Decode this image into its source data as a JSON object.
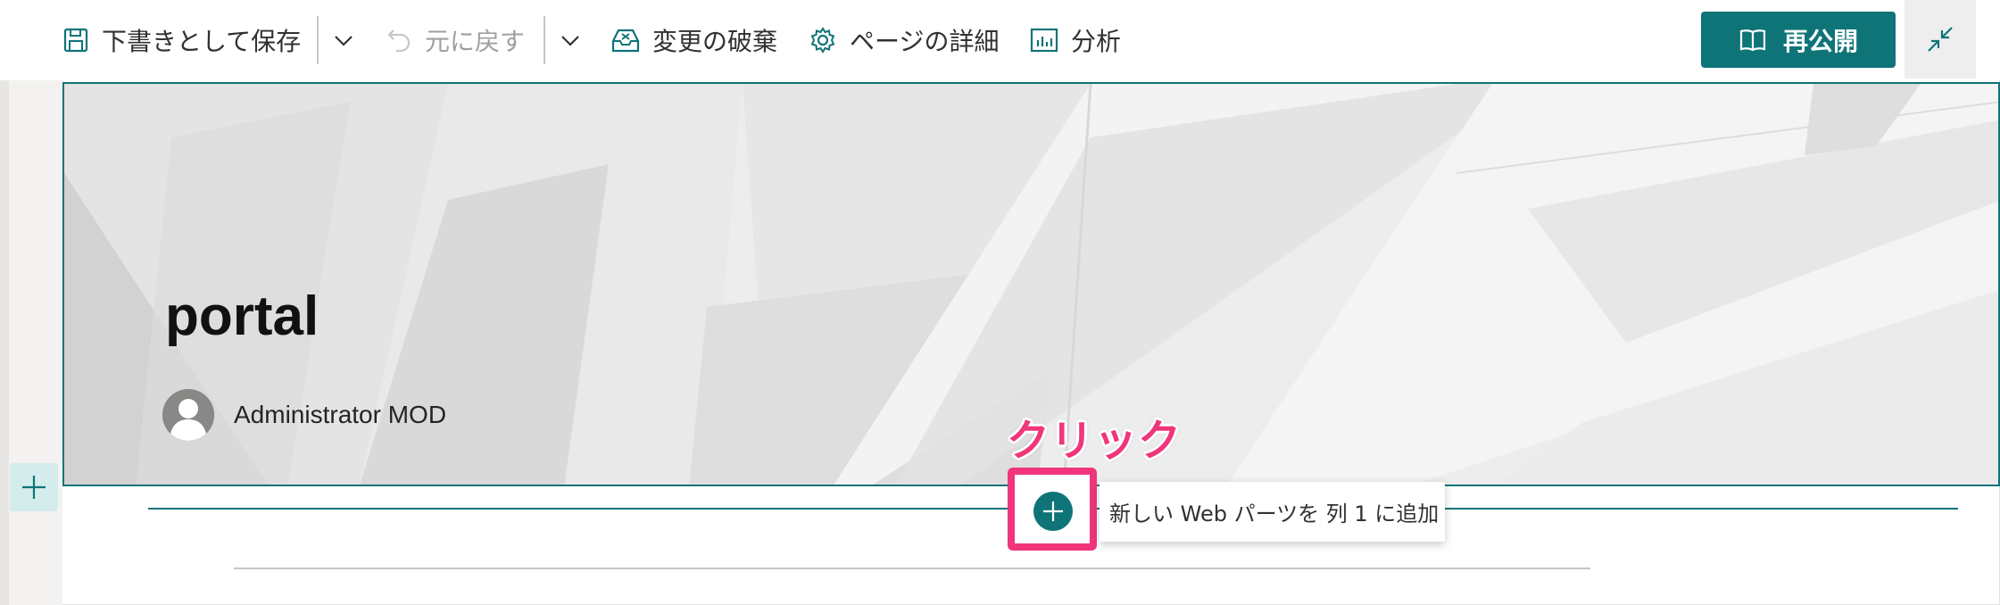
{
  "toolbar": {
    "save_label": "下書きとして保存",
    "save_dropdown_icon": "chevron-down-icon",
    "undo_label": "元に戻す",
    "undo_dropdown_icon": "chevron-down-icon",
    "discard_label": "変更の破棄",
    "page_details_label": "ページの詳細",
    "analytics_label": "分析",
    "republish_label": "再公開",
    "collapse_icon": "collapse-icon"
  },
  "hero": {
    "title": "portal",
    "author": "Administrator MOD"
  },
  "canvas": {
    "annotation": "クリック",
    "add_webpart_tooltip": "新しい Web パーツを 列 1 に追加"
  },
  "colors": {
    "accent": "#0f7478",
    "annotation": "#f0357b"
  }
}
